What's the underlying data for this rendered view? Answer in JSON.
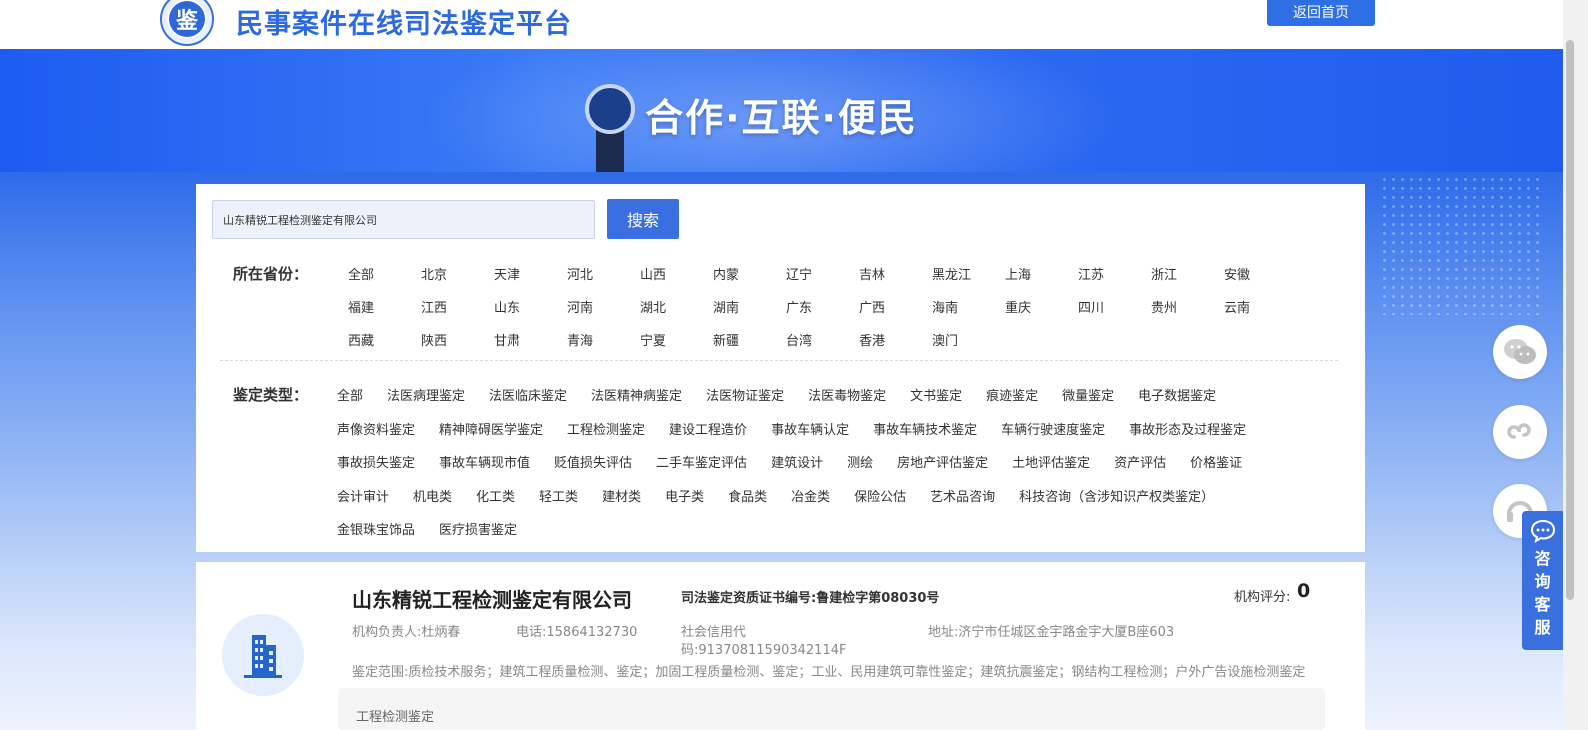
{
  "header": {
    "title": "民事案件在线司法鉴定平台",
    "logo_char": "鉴",
    "home_button": "返回首页"
  },
  "banner": {
    "slogan": "合作·互联·便民"
  },
  "search": {
    "value": "山东精锐工程检测鉴定有限公司",
    "button": "搜索"
  },
  "province_filter": {
    "label": "所在省份：",
    "options": [
      "全部",
      "北京",
      "天津",
      "河北",
      "山西",
      "内蒙",
      "辽宁",
      "吉林",
      "黑龙江",
      "上海",
      "江苏",
      "浙江",
      "安徽",
      "福建",
      "江西",
      "山东",
      "河南",
      "湖北",
      "湖南",
      "广东",
      "广西",
      "海南",
      "重庆",
      "四川",
      "贵州",
      "云南",
      "西藏",
      "陕西",
      "甘肃",
      "青海",
      "宁夏",
      "新疆",
      "台湾",
      "香港",
      "澳门"
    ]
  },
  "type_filter": {
    "label": "鉴定类型：",
    "rows": [
      [
        "全部",
        "法医病理鉴定",
        "法医临床鉴定",
        "法医精神病鉴定",
        "法医物证鉴定",
        "法医毒物鉴定",
        "文书鉴定",
        "痕迹鉴定",
        "微量鉴定",
        "电子数据鉴定"
      ],
      [
        "声像资料鉴定",
        "精神障碍医学鉴定",
        "工程检测鉴定",
        "建设工程造价",
        "事故车辆认定",
        "事故车辆技术鉴定",
        "车辆行驶速度鉴定",
        "事故形态及过程鉴定"
      ],
      [
        "事故损失鉴定",
        "事故车辆现市值",
        "贬值损失评估",
        "二手车鉴定评估",
        "建筑设计",
        "测绘",
        "房地产评估鉴定",
        "土地评估鉴定",
        "资产评估",
        "价格鉴证"
      ],
      [
        "会计审计",
        "机电类",
        "化工类",
        "轻工类",
        "建材类",
        "电子类",
        "食品类",
        "冶金类",
        "保险公估",
        "艺术品咨询",
        "科技咨询（含涉知识产权类鉴定）"
      ],
      [
        "金银珠宝饰品",
        "医疗损害鉴定"
      ]
    ]
  },
  "result": {
    "name": "山东精锐工程检测鉴定有限公司",
    "cert": "司法鉴定资质证书编号:鲁建检字第08030号",
    "score_label": "机构评分:",
    "score": "0",
    "principal": "机构负责人:杜炳春",
    "phone": "电话:15864132730",
    "credit_line1": "社会信用代",
    "credit_line2": "码:91370811590342114F",
    "address": "地址:济宁市任城区金宇路金宇大厦B座603",
    "scope": "鉴定范围:质检技术服务；建筑工程质量检测、鉴定；加固工程质量检测、鉴定；工业、民用建筑可靠性鉴定；建筑抗震鉴定；钢结构工程检测；户外广告设施检测鉴定",
    "tag": "工程检测鉴定"
  },
  "side": {
    "consult": "咨询客服",
    "icons": [
      "wechat-icon",
      "mini-program-icon",
      "headset-icon"
    ]
  },
  "colors": {
    "brand": "#2d6ae0",
    "button": "#3b6ee0",
    "banner": "#1d5cf0"
  }
}
